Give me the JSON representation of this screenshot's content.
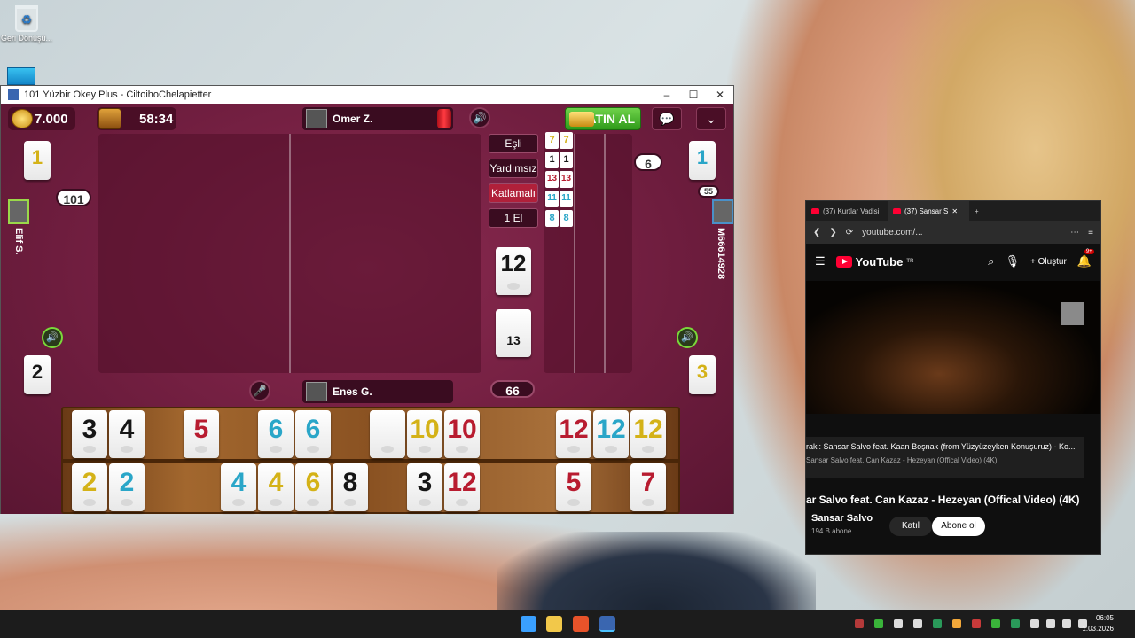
{
  "desktop": {
    "recycle_label": "Geri Dönüşü...",
    "taskbar": {
      "time": "06:05",
      "date": "1.03.2026"
    }
  },
  "game_window": {
    "title": "101 Yüzbir Okey Plus - CiltoihoChelapietter",
    "controls": {
      "minimize": "–",
      "maximize": "☐",
      "close": "✕"
    },
    "coins": "7.000",
    "timer": "58:34",
    "top_player": "Omer Z.",
    "bottom_player": "Enes G.",
    "buy_label": "SATIN AL",
    "modes": [
      "Eşli",
      "Yardımsız",
      "Katlamalı",
      "1 El"
    ],
    "left_player": "Elif S.",
    "right_player": "M66614928",
    "left_score_badge": "101",
    "right_score_badge": "6",
    "center_count": "66",
    "indicator_tile": "12",
    "deck_count": "13",
    "side_tiles": {
      "top_left": "1",
      "bottom_left": "2",
      "top_right": "1",
      "bottom_right": "3"
    },
    "mini_tiles": [
      [
        "7",
        "7"
      ],
      [
        "1",
        "1"
      ],
      [
        "13",
        "13"
      ],
      [
        "11",
        "11"
      ],
      [
        "8",
        "8"
      ]
    ],
    "corner_badge": "55",
    "rack_top": [
      {
        "v": "3",
        "c": "black"
      },
      {
        "v": "4",
        "c": "black"
      },
      {
        "v": "5",
        "c": "red"
      },
      {
        "v": "6",
        "c": "blue"
      },
      {
        "v": "6",
        "c": "blue"
      },
      {
        "v": "",
        "c": "blank"
      },
      {
        "v": "10",
        "c": "yellow"
      },
      {
        "v": "10",
        "c": "red"
      },
      {
        "v": "12",
        "c": "red"
      },
      {
        "v": "12",
        "c": "blue"
      },
      {
        "v": "12",
        "c": "yellow"
      }
    ],
    "rack_bottom": [
      {
        "v": "2",
        "c": "yellow"
      },
      {
        "v": "2",
        "c": "blue"
      },
      {
        "v": "4",
        "c": "blue"
      },
      {
        "v": "4",
        "c": "yellow"
      },
      {
        "v": "6",
        "c": "yellow"
      },
      {
        "v": "8",
        "c": "black"
      },
      {
        "v": "3",
        "c": "black"
      },
      {
        "v": "12",
        "c": "red"
      },
      {
        "v": "5",
        "c": "red"
      },
      {
        "v": "7",
        "c": "red"
      }
    ]
  },
  "youtube_window": {
    "tabs": [
      "(37) Kurtlar Vadisi",
      "(37) Sansar S"
    ],
    "url": "youtube.com/...",
    "logo": "YouTube",
    "logo_region": "TR",
    "create_label": "Oluştur",
    "notif_count": "9+",
    "upnext_title": "raki: Sansar Salvo feat. Kaan Boşnak (from Yüzyüzeyken Konuşuruz) - Ko...",
    "upnext_sub": "Sansar Salvo feat. Can Kazaz - Hezeyan (Offical Video) (4K)",
    "video_title": "ar Salvo feat. Can Kazaz - Hezeyan (Offical Video) (4K)",
    "channel": "Sansar Salvo",
    "subscribers": "194 B abone",
    "join_label": "Katıl",
    "subscribe_label": "Abone ol"
  }
}
